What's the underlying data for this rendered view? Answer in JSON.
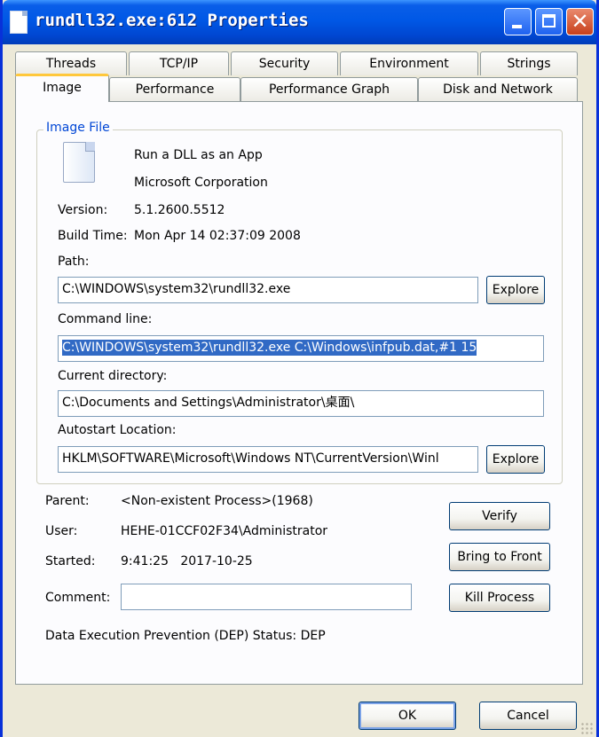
{
  "window": {
    "title": "rundll32.exe:612 Properties"
  },
  "tabs_row1": [
    "Threads",
    "TCP/IP",
    "Security",
    "Environment",
    "Strings"
  ],
  "tabs_row2": [
    "Image",
    "Performance",
    "Performance Graph",
    "Disk and Network"
  ],
  "image_file": {
    "group_title": "Image File",
    "description": "Run a DLL as an App",
    "company": "Microsoft Corporation",
    "version_label": "Version:",
    "version": "5.1.2600.5512",
    "build_time_label": "Build Time:",
    "build_time": "Mon Apr 14 02:37:09 2008",
    "path_label": "Path:",
    "path": "C:\\WINDOWS\\system32\\rundll32.exe",
    "command_line_label": "Command line:",
    "command_line": "C:\\WINDOWS\\system32\\rundll32.exe C:\\Windows\\infpub.dat,#1 15",
    "current_dir_label": "Current directory:",
    "current_dir": "C:\\Documents and Settings\\Administrator\\桌面\\",
    "autostart_label": "Autostart Location:",
    "autostart": "HKLM\\SOFTWARE\\Microsoft\\Windows NT\\CurrentVersion\\Winl",
    "explore_label": "Explore"
  },
  "process": {
    "parent_label": "Parent:",
    "parent": "<Non-existent Process>(1968)",
    "user_label": "User:",
    "user": "HEHE-01CCF02F34\\Administrator",
    "started_label": "Started:",
    "started": "9:41:25   2017-10-25",
    "comment_label": "Comment:",
    "comment": "",
    "dep_label": "Data Execution Prevention (DEP) Status:",
    "dep": "DEP"
  },
  "buttons": {
    "verify": "Verify",
    "bring_to_front": "Bring to Front",
    "kill_process": "Kill Process",
    "ok": "OK",
    "cancel": "Cancel"
  }
}
